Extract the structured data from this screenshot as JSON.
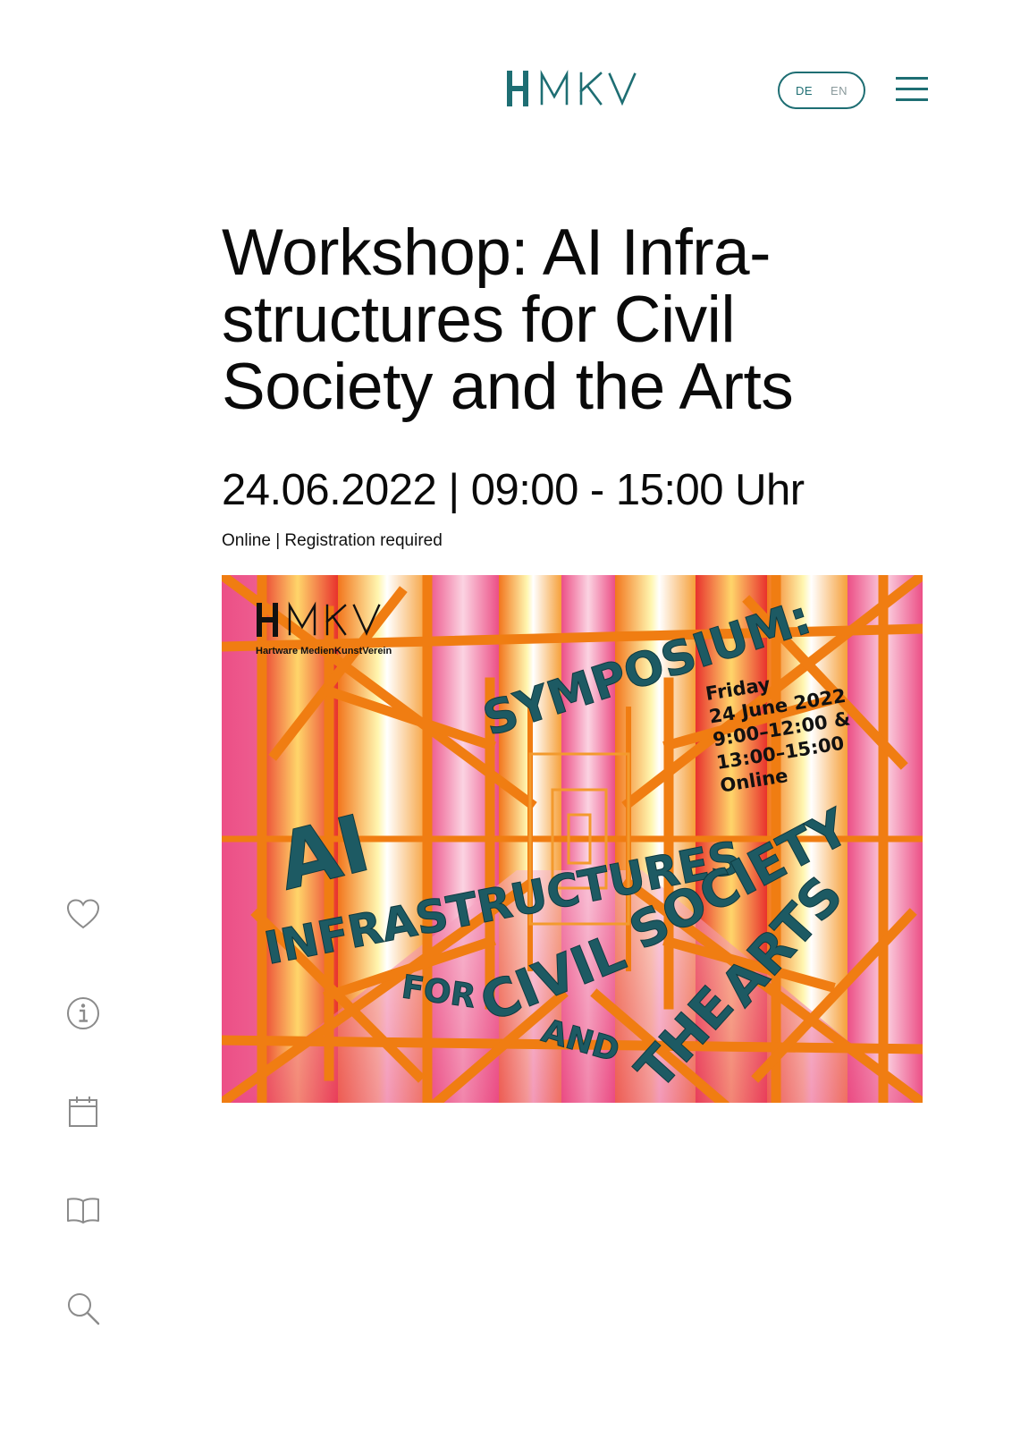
{
  "header": {
    "logo_text": "HMKV",
    "lang_options": [
      "DE",
      "EN"
    ],
    "active_lang": "DE",
    "menu_icon": "hamburger-menu-icon"
  },
  "sidebar": {
    "items": [
      {
        "icon": "heart-icon"
      },
      {
        "icon": "info-icon"
      },
      {
        "icon": "calendar-icon"
      },
      {
        "icon": "book-icon"
      },
      {
        "icon": "search-icon"
      }
    ]
  },
  "event": {
    "title_lines": [
      "Workshop: AI Infra-",
      "structures for Civil",
      "Society and the Arts"
    ],
    "date_time": "24.06.2022 | 09:00 - 15:00 Uhr",
    "meta": "Online | Registration required"
  },
  "poster": {
    "logo": "HMKV",
    "org_name": "Hartware MedienKunstVerein",
    "heading": "SYMPOSIUM:",
    "date_lines": [
      "Friday",
      "24 June 2022",
      "9:00–12:00 &",
      "13:00–15:00",
      "Online"
    ],
    "title_words": [
      "AI",
      "INFRASTRUCTURES",
      "FOR",
      "CIVIL",
      "SOCIETY",
      "AND",
      "THE",
      "ARTS"
    ]
  },
  "colors": {
    "accent": "#1e6e73",
    "poster_text": "#1d5a63",
    "poster_orange": "#f08a1a",
    "poster_pink": "#ec5c93",
    "poster_yellow": "#fff3a0"
  }
}
